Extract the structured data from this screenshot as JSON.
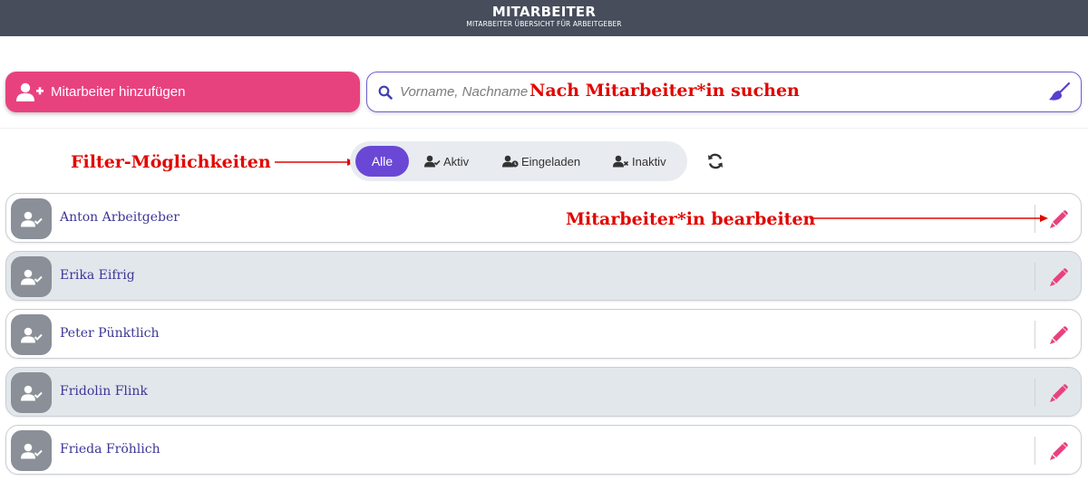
{
  "header": {
    "title": "MITARBEITER",
    "subtitle": "MITARBEITER ÜBERSICHT FÜR ARBEITGEBER"
  },
  "toolbar": {
    "add_label": "Mitarbeiter hinzufügen",
    "add_icon": "user-plus-icon"
  },
  "search": {
    "placeholder": "Vorname, Nachname",
    "value": "",
    "search_icon": "search-icon",
    "clear_icon": "broom-icon"
  },
  "filters": [
    {
      "label": "Alle",
      "active": true,
      "icon": ""
    },
    {
      "label": "Aktiv",
      "active": false,
      "icon": "user-check-icon"
    },
    {
      "label": "Eingeladen",
      "active": false,
      "icon": "user-clock-icon"
    },
    {
      "label": "Inaktiv",
      "active": false,
      "icon": "user-times-icon"
    }
  ],
  "refresh_icon": "refresh-icon",
  "annotations": {
    "search": "Nach Mitarbeiter*in suchen",
    "filter": "Filter-Möglichkeiten",
    "edit": "Mitarbeiter*in bearbeiten"
  },
  "employees": [
    {
      "name": "Anton Arbeitgeber"
    },
    {
      "name": "Erika Eifrig"
    },
    {
      "name": "Peter Pünktlich"
    },
    {
      "name": "Fridolin Flink"
    },
    {
      "name": "Frieda Fröhlich"
    }
  ],
  "colors": {
    "header_bg": "#474d5b",
    "accent_pink": "#e8427e",
    "accent_purple": "#6b47d6",
    "annotation_red": "#e10600",
    "name_color": "#3d3696"
  }
}
